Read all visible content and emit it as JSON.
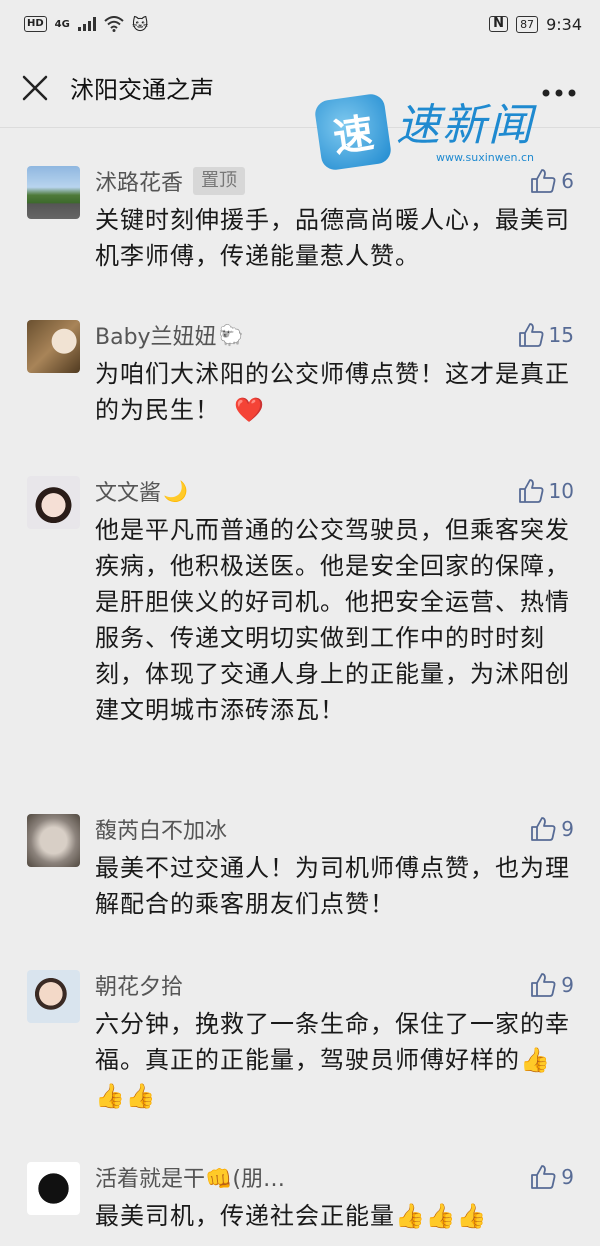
{
  "status_bar": {
    "hd": "HD",
    "signal": "4G",
    "emoji": "🐱",
    "nfc": "N",
    "battery": "87",
    "time": "9:34"
  },
  "header": {
    "title": "沭阳交通之声"
  },
  "watermark": {
    "seal": "速",
    "name": "速新闻",
    "url": "www.suxinwen.cn"
  },
  "comments": [
    {
      "name": "沭路花香",
      "badge": "置顶",
      "likes": "6",
      "text": "关键时刻伸援手，品德高尚暖人心，最美司机李师傅，传递能量惹人赞。"
    },
    {
      "name": "Baby兰妞妞",
      "name_emoji": "🐑",
      "likes": "15",
      "text": "为咱们大沭阳的公交师傅点赞！这才是真正的为民生！",
      "text_emoji": "❤️"
    },
    {
      "name": "文文酱",
      "name_emoji": "🌙",
      "likes": "10",
      "text": "他是平凡而普通的公交驾驶员，但乘客突发疾病，他积极送医。他是安全回家的保障，是肝胆侠义的好司机。他把安全运营、热情服务、传递文明切实做到工作中的时时刻刻，体现了交通人身上的正能量，为沭阳创建文明城市添砖添瓦！"
    },
    {
      "name": "馥芮白不加冰",
      "likes": "9",
      "text": "最美不过交通人！为司机师傅点赞，也为理解配合的乘客朋友们点赞！"
    },
    {
      "name": "朝花夕拾",
      "likes": "9",
      "text": "六分钟，挽救了一条生命，保住了一家的幸福。真正的正能量，驾驶员师傅好样的",
      "text_emoji": "👍👍👍"
    },
    {
      "name": "活着就是干👊(朋…",
      "likes": "9",
      "text": "最美司机，传递社会正能量",
      "text_emoji": "👍👍👍"
    }
  ]
}
